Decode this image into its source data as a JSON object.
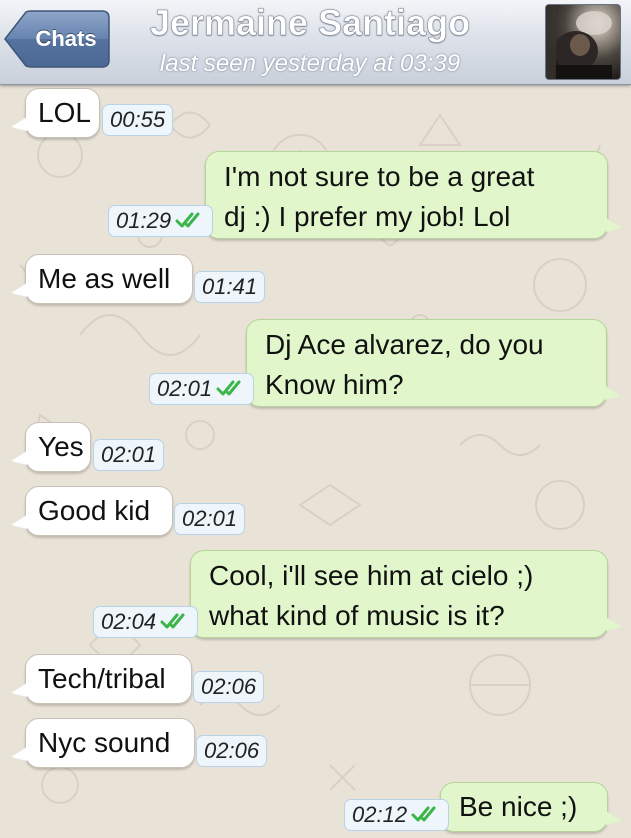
{
  "header": {
    "back_label": "Chats",
    "contact_name": "Jermaine Santiago",
    "status": "last seen yesterday at 03:39"
  },
  "colors": {
    "incoming_bubble": "#ffffff",
    "outgoing_bubble": "#e1f7cb",
    "read_checks": "#3cb54a",
    "header_back_button": "#5a79a8"
  },
  "messages": [
    {
      "direction": "incoming",
      "text": "LOL",
      "time": "00:55",
      "read": false
    },
    {
      "direction": "outgoing",
      "text_lines": [
        "I'm not sure to be a great",
        "dj :) I prefer my job! Lol"
      ],
      "time": "01:29",
      "read": true
    },
    {
      "direction": "incoming",
      "text": "Me as well",
      "time": "01:41",
      "read": false
    },
    {
      "direction": "outgoing",
      "text_lines": [
        "Dj Ace alvarez, do you",
        "Know him?"
      ],
      "time": "02:01",
      "read": true
    },
    {
      "direction": "incoming",
      "text": "Yes",
      "time": "02:01",
      "read": false
    },
    {
      "direction": "incoming",
      "text": "Good kid",
      "time": "02:01",
      "read": false
    },
    {
      "direction": "outgoing",
      "text_lines": [
        "Cool, i'll see him at cielo ;)",
        "what kind of music is it?"
      ],
      "time": "02:04",
      "read": true
    },
    {
      "direction": "incoming",
      "text": "Tech/tribal",
      "time": "02:06",
      "read": false
    },
    {
      "direction": "incoming",
      "text": "Nyc sound",
      "time": "02:06",
      "read": false
    },
    {
      "direction": "outgoing",
      "text": "Be nice ;)",
      "time": "02:12",
      "read": true
    }
  ]
}
